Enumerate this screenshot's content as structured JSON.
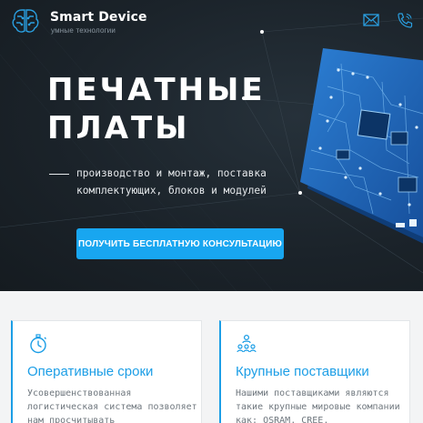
{
  "header": {
    "brand_name": "Smart Device",
    "brand_tagline": "умные технологии",
    "icons": [
      "brain-circuit-logo",
      "mail-icon",
      "phone-icon"
    ]
  },
  "hero": {
    "title_line1": "ПЕЧАТНЫЕ",
    "title_line2": "ПЛАТЫ",
    "subtitle": "производство и монтаж, поставка комплектующих, блоков и модулей",
    "cta_label": "ПОЛУЧИТЬ БЕСПЛАТНУЮ КОНСУЛЬТАЦИЮ"
  },
  "features": [
    {
      "icon": "stopwatch-icon",
      "title": "Оперативные сроки",
      "text": "Усовершенствованная логистическая система позволяет нам просчитывать"
    },
    {
      "icon": "supplier-network-icon",
      "title": "Крупные поставщики",
      "text": "Нашими поставщиками являются такие крупные мировые компании как: OSRAM, CREE,"
    }
  ],
  "colors": {
    "accent": "#18a6f0",
    "hero_bg": "#1b232a",
    "card_title": "#1c9ee6",
    "pcb": "#1f62b5"
  }
}
